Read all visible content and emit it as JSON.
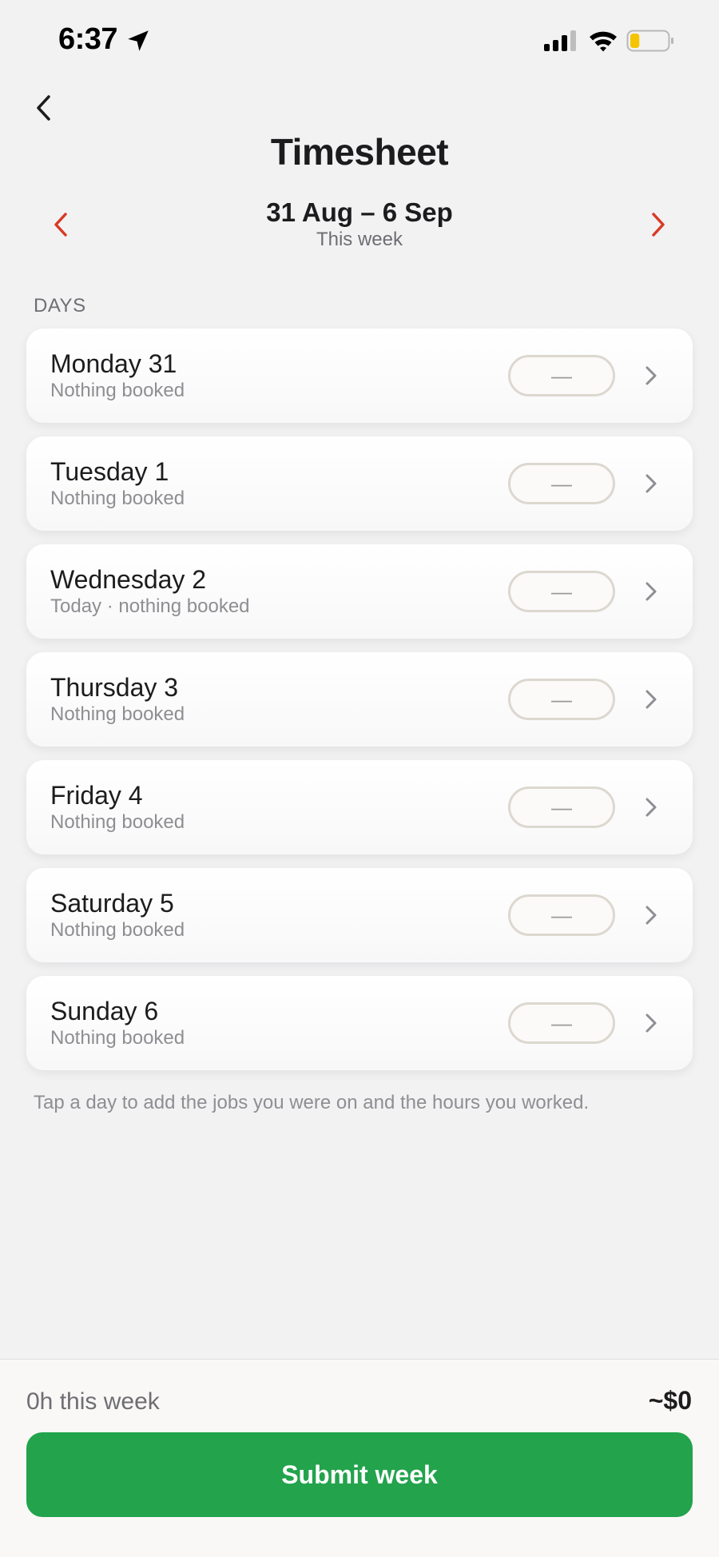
{
  "status_bar": {
    "time": "6:37"
  },
  "header": {
    "title": "Timesheet"
  },
  "week": {
    "range": "31 Aug – 6 Sep",
    "subtitle": "This week"
  },
  "days_section": {
    "header": "DAYS",
    "items": [
      {
        "name": "Monday 31",
        "status": "Nothing booked",
        "hours": "—"
      },
      {
        "name": "Tuesday 1",
        "status": "Nothing booked",
        "hours": "—"
      },
      {
        "name": "Wednesday 2",
        "status": "Today · nothing booked",
        "hours": "—"
      },
      {
        "name": "Thursday 3",
        "status": "Nothing booked",
        "hours": "—"
      },
      {
        "name": "Friday 4",
        "status": "Nothing booked",
        "hours": "—"
      },
      {
        "name": "Saturday 5",
        "status": "Nothing booked",
        "hours": "—"
      },
      {
        "name": "Sunday 6",
        "status": "Nothing booked",
        "hours": "—"
      }
    ],
    "hint": "Tap a day to add the jobs you were on and the hours you worked."
  },
  "footer": {
    "hours_total": "0h this week",
    "amount": "~$0",
    "submit_label": "Submit week"
  },
  "colors": {
    "accent_red": "#d93a26",
    "submit_green": "#22a34c",
    "battery_level": "#f5c400"
  },
  "icons": {
    "status": [
      "location-arrow-icon",
      "cellular-signal-icon",
      "wifi-icon",
      "battery-icon"
    ],
    "navigation": [
      "back-chevron-icon",
      "chevron-left-icon",
      "chevron-right-icon"
    ],
    "row": "chevron-right-icon"
  },
  "battery": {
    "level": 0.25
  }
}
